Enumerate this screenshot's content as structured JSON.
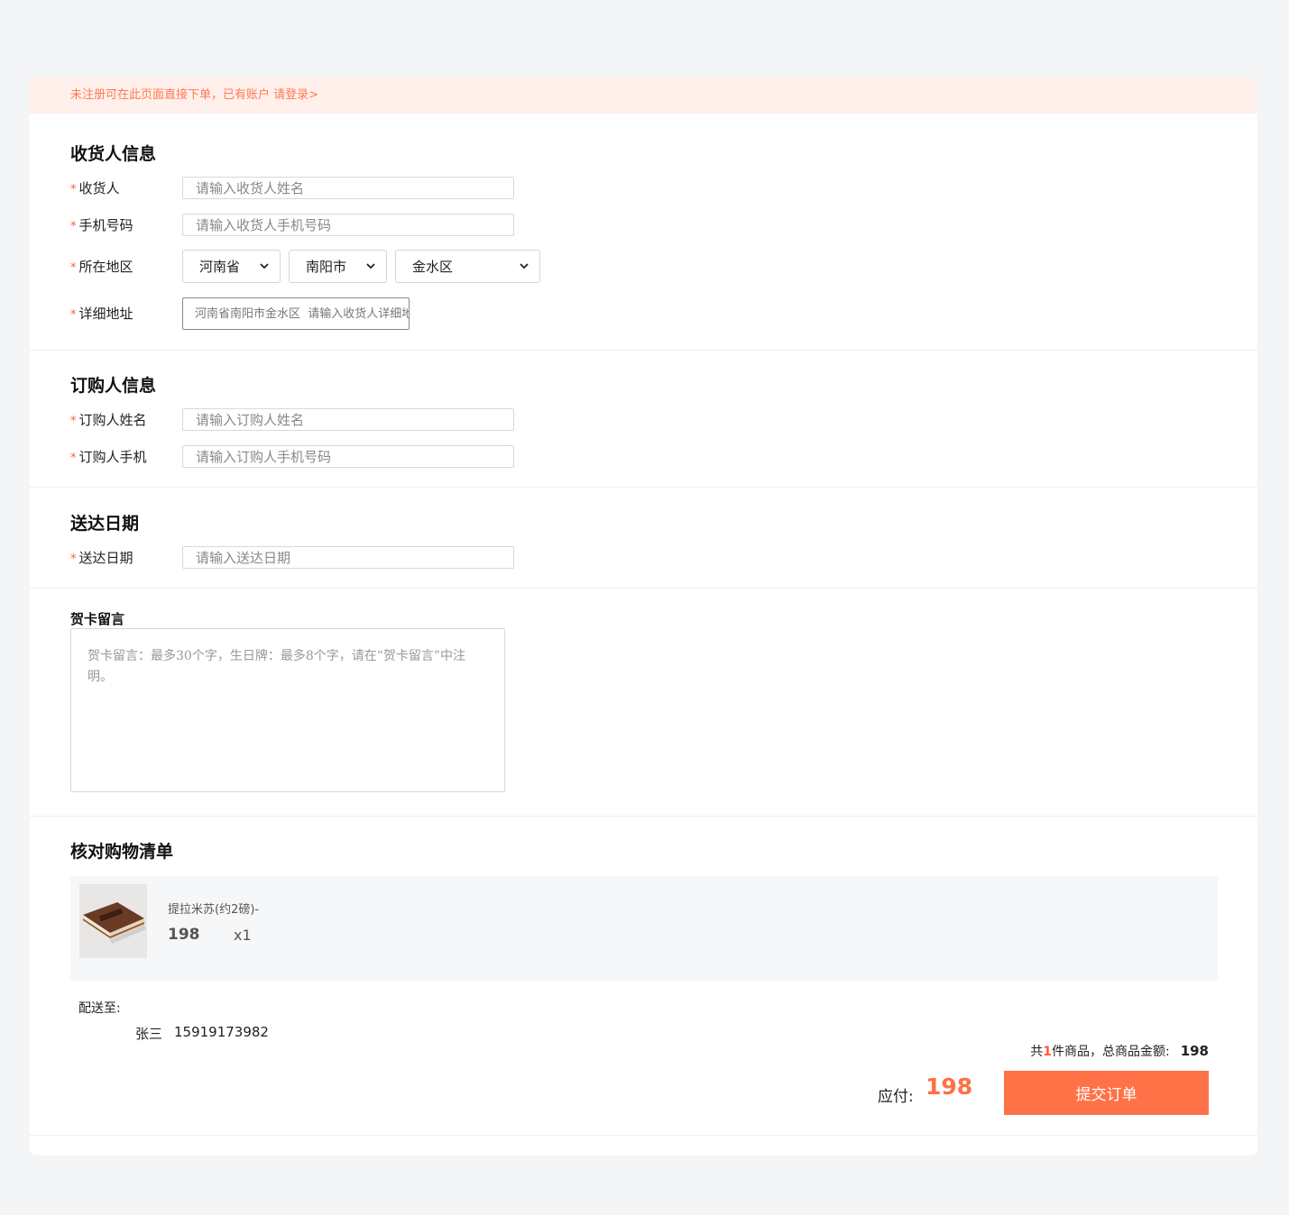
{
  "notice": {
    "text": "未注册可在此页面直接下单，已有账户 ",
    "login_link": "请登录>"
  },
  "receiver": {
    "title": "收货人信息",
    "star": "*",
    "name_label": "收货人",
    "name_placeholder": "请输入收货人姓名",
    "phone_label": "手机号码",
    "phone_placeholder": "请输入收货人手机号码",
    "region_label": "所在地区",
    "province": "河南省",
    "city": "南阳市",
    "district": "金水区",
    "address_label": "详细地址",
    "address_placeholder": "河南省南阳市金水区  请输入收货人详细地址"
  },
  "buyer": {
    "title": "订购人信息",
    "name_label": "订购人姓名",
    "name_placeholder": "请输入订购人姓名",
    "phone_label": "订购人手机",
    "phone_placeholder": "请输入订购人手机号码"
  },
  "delivery": {
    "title": "送达日期",
    "date_label": "送达日期",
    "date_placeholder": "请输入送达日期"
  },
  "card_message": {
    "title": "贺卡留言",
    "placeholder": "贺卡留言：最多30个字，生日牌：最多8个字，请在“贺卡留言”中注明。"
  },
  "checklist": {
    "title": "核对购物清单",
    "item": {
      "name": "提拉米苏(约2磅)-",
      "price": "198",
      "qty": "x1",
      "image_icon": "cake-image"
    },
    "ship_label": "配送至:",
    "ship_name": "张三",
    "ship_phone": "15919173982"
  },
  "summary": {
    "prefix": "共",
    "count": "1",
    "suffix": "件商品，总商品金额:",
    "amount": "198",
    "pay_label": "应付:",
    "pay_value": "198",
    "submit_label": "提交订单"
  },
  "colors": {
    "accent": "#ff7247",
    "notice_bg": "#fff0ec",
    "required_star": "#ff5a36"
  }
}
